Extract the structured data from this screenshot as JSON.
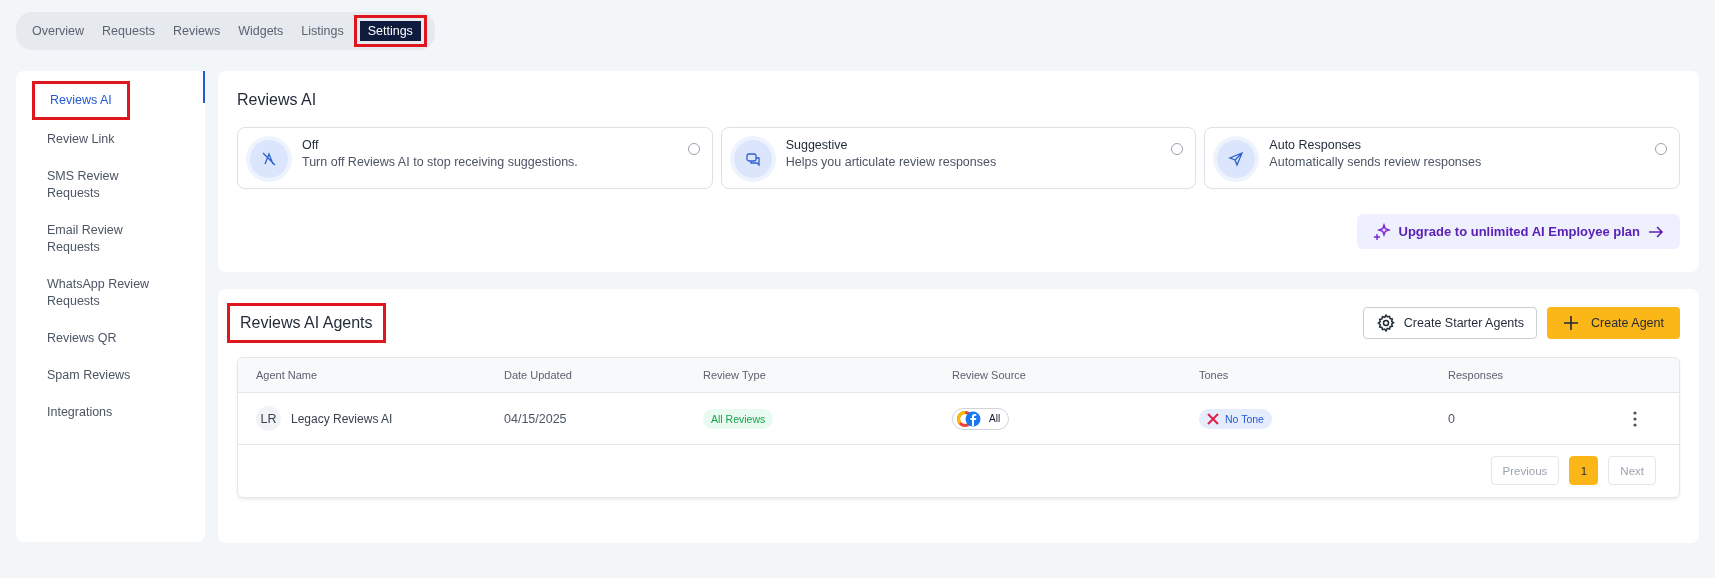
{
  "tabs": [
    {
      "label": "Overview",
      "selected": false,
      "highlighted": false
    },
    {
      "label": "Requests",
      "selected": false,
      "highlighted": false
    },
    {
      "label": "Reviews",
      "selected": false,
      "highlighted": false
    },
    {
      "label": "Widgets",
      "selected": false,
      "highlighted": false
    },
    {
      "label": "Listings",
      "selected": false,
      "highlighted": false
    },
    {
      "label": "Settings",
      "selected": true,
      "highlighted": true
    }
  ],
  "sidebar": {
    "items": [
      {
        "label": "Reviews AI",
        "selected": true,
        "highlighted": true
      },
      {
        "label": "Review Link",
        "selected": false,
        "highlighted": false
      },
      {
        "label": "SMS Review Requests",
        "selected": false,
        "highlighted": false
      },
      {
        "label": "Email Review Requests",
        "selected": false,
        "highlighted": false
      },
      {
        "label": "WhatsApp Review Requests",
        "selected": false,
        "highlighted": false
      },
      {
        "label": "Reviews QR",
        "selected": false,
        "highlighted": false
      },
      {
        "label": "Spam Reviews",
        "selected": false,
        "highlighted": false
      },
      {
        "label": "Integrations",
        "selected": false,
        "highlighted": false
      }
    ]
  },
  "reviews_ai": {
    "title": "Reviews AI",
    "options": [
      {
        "kind": "off",
        "title": "Off",
        "description": "Turn off Reviews AI to stop receiving suggestions.",
        "selected": false
      },
      {
        "kind": "suggestive",
        "title": "Suggestive",
        "description": "Helps you articulate review responses",
        "selected": false
      },
      {
        "kind": "auto",
        "title": "Auto Responses",
        "description": "Automatically sends review responses",
        "selected": false
      }
    ],
    "upgrade_button": "Upgrade to unlimited AI Employee plan"
  },
  "agents": {
    "title": "Reviews AI Agents",
    "title_highlighted": true,
    "starter_button": "Create Starter Agents",
    "create_button": "Create Agent",
    "table": {
      "columns": [
        "Agent Name",
        "Date Updated",
        "Review Type",
        "Review Source",
        "Tones",
        "Responses"
      ],
      "rows": [
        {
          "initials": "LR",
          "name": "Legacy Reviews AI",
          "date": "04/15/2025",
          "review_type": "All Reviews",
          "review_source": "All",
          "tone": "No Tone",
          "responses": "0"
        }
      ]
    },
    "pagination": {
      "previous": {
        "label": "Previous",
        "disabled": true
      },
      "pages": [
        {
          "label": "1",
          "selected": true
        }
      ],
      "next": {
        "label": "Next",
        "disabled": true
      }
    }
  }
}
